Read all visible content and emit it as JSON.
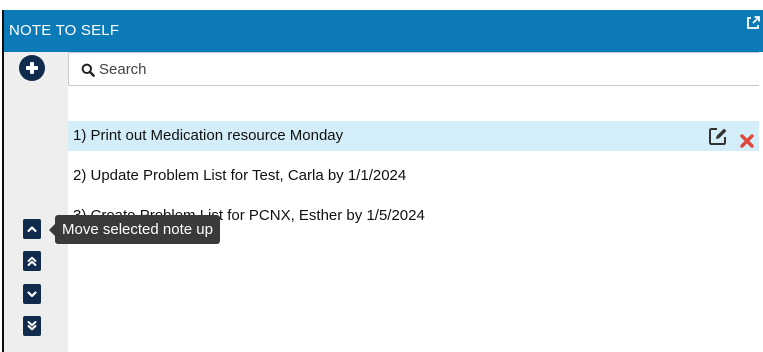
{
  "header": {
    "title": "NOTE TO SELF",
    "popout_icon": "external-link-icon"
  },
  "toolbar": {
    "add_icon": "plus-circle-icon"
  },
  "search": {
    "placeholder": "Search",
    "value": "",
    "icon": "search-icon"
  },
  "notes": [
    {
      "text": "1) Print out Medication resource Monday",
      "selected": true
    },
    {
      "text": "2) Update Problem List for Test, Carla by 1/1/2024",
      "selected": false
    },
    {
      "text": "3) Create Problem List for PCNX, Esther by 1/5/2024",
      "selected": false
    }
  ],
  "row_actions": {
    "edit_icon": "edit-icon",
    "delete_icon": "close-icon"
  },
  "move_buttons": [
    {
      "icon": "chevron-up-icon"
    },
    {
      "icon": "double-chevron-up-icon"
    },
    {
      "icon": "chevron-down-icon"
    },
    {
      "icon": "double-chevron-down-icon"
    }
  ],
  "tooltip": {
    "text": "Move selected note up"
  },
  "colors": {
    "header_bg": "#0c7ab6",
    "selected_row_bg": "#d3eef8",
    "button_navy": "#102b4c",
    "delete_red": "#e0463a",
    "tooltip_bg": "#3a3a3a"
  }
}
